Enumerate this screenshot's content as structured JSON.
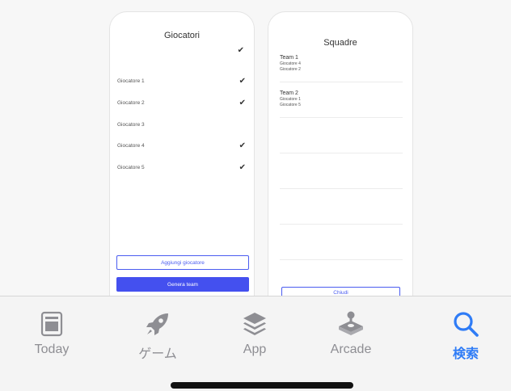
{
  "players_screen": {
    "title": "Giocatori",
    "players": [
      {
        "name": "Giocatore 1",
        "checked": true
      },
      {
        "name": "Giocatore 2",
        "checked": true
      },
      {
        "name": "Giocatore 3",
        "checked": false
      },
      {
        "name": "Giocatore 4",
        "checked": true
      },
      {
        "name": "Giocatore 5",
        "checked": true
      }
    ],
    "check_glyph": "✔",
    "add_button": "Aggiungi giocatore",
    "generate_button": "Genera team"
  },
  "teams_screen": {
    "title": "Squadre",
    "teams": [
      {
        "name": "Team 1",
        "members": [
          "Giocatore 4",
          "Giocatore 2"
        ]
      },
      {
        "name": "Team 2",
        "members": [
          "Giocatore 1",
          "Giocatore 5"
        ]
      }
    ],
    "close_button": "Chiudi"
  },
  "tabbar": {
    "tabs": [
      {
        "label": "Today",
        "icon": "today-icon",
        "active": false
      },
      {
        "label": "ゲーム",
        "icon": "rocket-icon",
        "active": false
      },
      {
        "label": "App",
        "icon": "layers-icon",
        "active": false
      },
      {
        "label": "Arcade",
        "icon": "joystick-icon",
        "active": false
      },
      {
        "label": "検索",
        "icon": "search-icon",
        "active": true
      }
    ],
    "colors": {
      "active": "#2f7cf6",
      "inactive": "#8e8e93"
    }
  }
}
